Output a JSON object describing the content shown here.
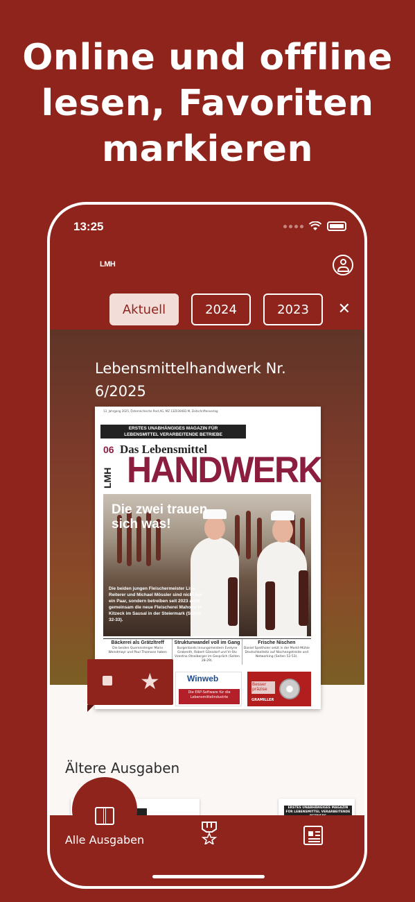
{
  "promo": {
    "headline_line1": "Online und offline",
    "headline_line2": "lesen, Favoriten",
    "headline_line3": "markieren"
  },
  "status_bar": {
    "time": "13:25"
  },
  "header": {
    "logo_text": "LMH"
  },
  "tabs": [
    {
      "label": "Aktuell",
      "active": true
    },
    {
      "label": "2024",
      "active": false
    },
    {
      "label": "2023",
      "active": false
    }
  ],
  "current_issue": {
    "title_line1": "Lebensmittelhandwerk Nr.",
    "title_line2": "6/2025"
  },
  "cover": {
    "top_text": "13. Jahrgang 2025, Österreichische Post AG, MZ 13Z039483 M, Zeitschriftenverlag",
    "banner_line1": "ERSTES UNABHÄNGIGES MAGAZIN FÜR",
    "banner_line2": "LEBENSMITTEL VERARBEITENDE BETRIEBE",
    "issue_number": "06",
    "das_lebensmittel": "Das Lebensmittel",
    "lmh": "LMH",
    "handwerk": "HANDWERK",
    "photo_title_line1": "Die zwei trauen",
    "photo_title_line2": "sich was!",
    "photo_text": "Die beiden jungen Fleischermeister Lisa Reiterer und Michael Mössler sind nicht nur ein Paar, sondern betreiben seit 2023 auch gemeinsam die neue Fleischerei Mahoter in Kitzeck im Sausal in der Steiermark (Seiten 32-33).",
    "columns": [
      {
        "heading": "Bäckerei als Grätzltreff",
        "text": "Die beiden Quereinsteiger Mario Weindmayr und Paul Thomann haben"
      },
      {
        "heading": "Strukturwandel voll im Gang",
        "text": "Burgenlands Innungsmeistern Evelyne Grabenth, Robert Gänsdorf und Vr-Stv Vzentno Otseiberger im Gespräch (Seiten 28-29)."
      },
      {
        "heading": "Frische Nischen",
        "text": "Daniel Speitholer setzt in der Markt-Mühle Deutschkeiteitz auf Nischengetreide und Networking (Seiten 52-53)."
      }
    ],
    "ad_winweb": "Winweb",
    "ad_winweb_sub": "Die ERP-Software für die Lebensmittelindustrie",
    "ad_gram_text": "Besser präzise",
    "ad_gram_brand": "GRAMILLER"
  },
  "older": {
    "title": "Ältere Ausgaben"
  },
  "thumb2": {
    "banner": "ERSTES UNABHÄNGIGES MAGAZIN FÜR LEBENSMITTEL VERARBEITENDE BETRIEBE"
  },
  "tabbar": {
    "all_issues": "Alle Ausgaben"
  },
  "colors": {
    "brand": "#8f241c",
    "tab_active_bg": "#f2ddd8",
    "cover_accent": "#8b1e3f"
  },
  "icons": [
    "user-icon",
    "close-icon",
    "download-icon",
    "star-icon",
    "book-icon",
    "badge-icon",
    "newspaper-icon",
    "wifi-icon",
    "battery-icon"
  ]
}
